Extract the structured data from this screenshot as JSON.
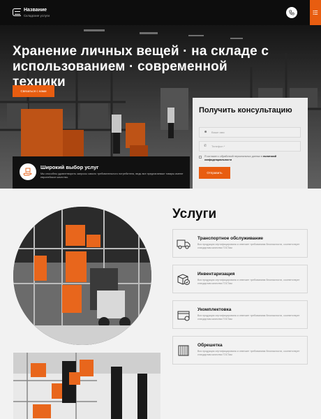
{
  "header": {
    "brand_title": "Название",
    "brand_subtitle": "Складские услуги",
    "phone_icon": "phone-icon",
    "menu_icon": "list-icon",
    "accent": "#e85d10"
  },
  "hero": {
    "title": "Хранение личных вещей · на складе с использованием · современной техники",
    "cta_label": "Связаться с нами",
    "feature": {
      "icon": "box-hand-icon",
      "title": "Широкий выбор услуг",
      "text": "Мы способны удовлетворить запросы самого требовательного потребителя, ведь все предлагаемые товары имеют европейское качество."
    }
  },
  "consult": {
    "title": "Получить консультацию",
    "name_placeholder": "Ваше имя",
    "phone_placeholder": "Телефон *",
    "consent_text": "Я согласен с обработкой персональных данных в",
    "consent_link": "политикой конфиденциальности",
    "submit_label": "Отправить"
  },
  "services": {
    "title": "Услуги",
    "items": [
      {
        "title": "Транспортное обслуживание",
        "text": "Вся продукция сертифицирована и отвечает требованиям безопасности, соответствует стандартам качества ГОСТам",
        "icon": "truck-icon"
      },
      {
        "title": "Инвентаризация",
        "text": "Вся продукция сертифицирована и отвечает требованиям безопасности, соответствует стандартам качества ГОСТам",
        "icon": "box-check-icon"
      },
      {
        "title": "Укомплектовка",
        "text": "Вся продукция сертифицирована и отвечает требованиям безопасности, соответствует стандартам качества ГОСТам",
        "icon": "package-icon"
      },
      {
        "title": "Обрешетка",
        "text": "Вся продукция сертифицирована и отвечает требованиям безопасности, соответствует стандартам качества ГОСТам",
        "icon": "crate-icon"
      }
    ]
  }
}
